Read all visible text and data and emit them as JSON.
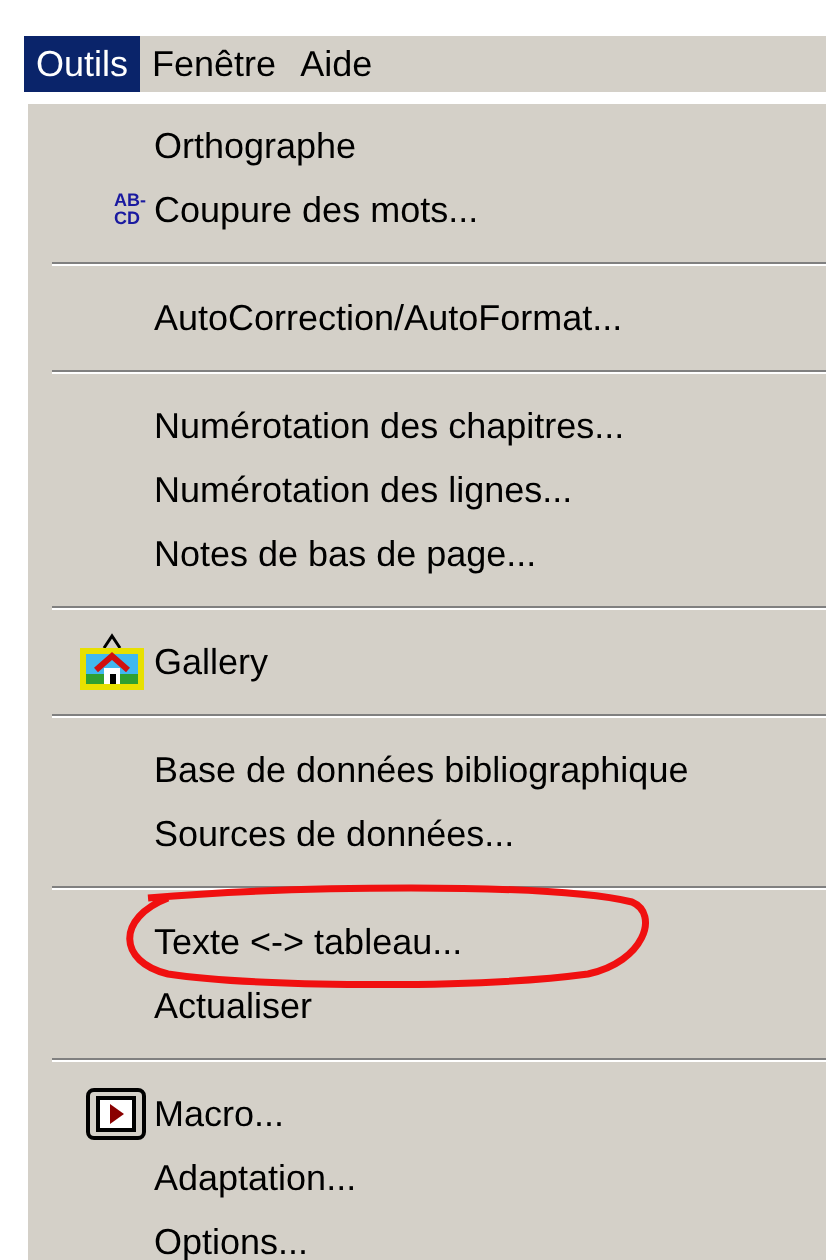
{
  "menu_bar": [
    {
      "label": "Outils",
      "selected": true
    },
    {
      "label": "Fenêtre",
      "selected": false
    },
    {
      "label": "Aide",
      "selected": false
    }
  ],
  "menu": {
    "items": [
      {
        "kind": "item",
        "label": "Orthographe"
      },
      {
        "kind": "text_icon_item",
        "label": "Coupure des mots...",
        "icon_text": [
          "AB-",
          "CD"
        ]
      },
      {
        "kind": "separator"
      },
      {
        "kind": "item",
        "label": "AutoCorrection/AutoFormat..."
      },
      {
        "kind": "separator"
      },
      {
        "kind": "item",
        "label": "Numérotation des chapitres..."
      },
      {
        "kind": "item",
        "label": "Numérotation des lignes..."
      },
      {
        "kind": "item",
        "label": "Notes de bas de page..."
      },
      {
        "kind": "separator"
      },
      {
        "kind": "gallery_item",
        "label": "Gallery"
      },
      {
        "kind": "separator"
      },
      {
        "kind": "item",
        "label": "Base de données bibliographique"
      },
      {
        "kind": "item",
        "label": "Sources de données..."
      },
      {
        "kind": "separator"
      },
      {
        "kind": "item",
        "label": "Texte <-> tableau...",
        "circled": true
      },
      {
        "kind": "item",
        "label": "Actualiser"
      },
      {
        "kind": "separator"
      },
      {
        "kind": "macro_item",
        "label": "Macro..."
      },
      {
        "kind": "item",
        "label": "Adaptation..."
      },
      {
        "kind": "item",
        "label": "Options..."
      }
    ]
  }
}
